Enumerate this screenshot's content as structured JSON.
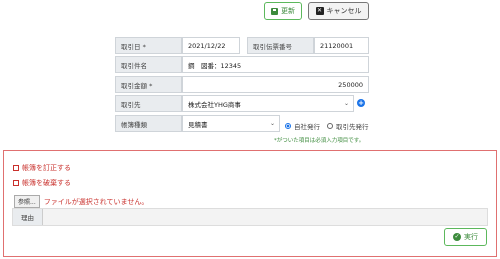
{
  "toolbar": {
    "update_label": "更新",
    "cancel_label": "キャンセル"
  },
  "form": {
    "date_label": "取引日 *",
    "date_value": "2021/12/22",
    "slip_label": "取引伝票番号",
    "slip_value": "21120001",
    "subject_label": "取引件名",
    "subject_value": "鋼　図番：12345",
    "amount_label": "取引金額 *",
    "amount_value": "250000",
    "partner_label": "取引先",
    "partner_value": "株式会社YHG商事",
    "doctype_label": "帳簿種類",
    "doctype_value": "見積書",
    "radio_own": "自社発行",
    "radio_partner": "取引先発行",
    "required_note": "*がついた項目は必須入力項目です。"
  },
  "panel": {
    "correct_label": "帳簿を訂正する",
    "discard_label": "帳簿を破棄する",
    "file_button": "参照...",
    "file_status": "ファイルが選択されていません。",
    "reason_label": "理由",
    "execute_label": "実行"
  },
  "colors": {
    "accent_green": "#3c8b3c",
    "danger_red": "#c9302c",
    "primary_blue": "#1a73e8"
  }
}
